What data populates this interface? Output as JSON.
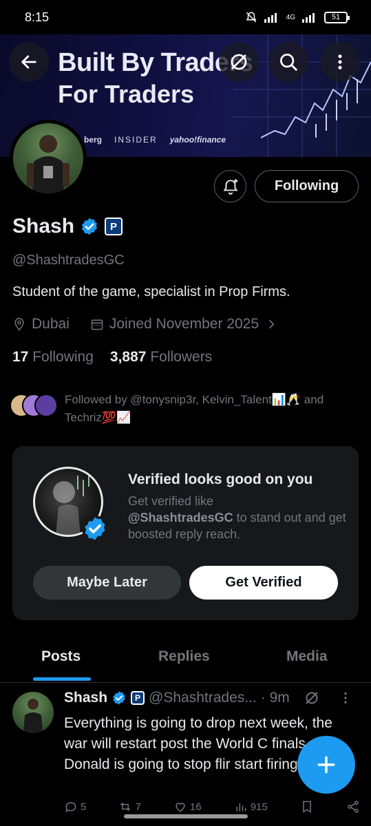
{
  "status_bar": {
    "time": "8:15",
    "network": "4G",
    "battery": "51"
  },
  "banner": {
    "line1": "Built By Traders",
    "line2": "For Traders",
    "logos": [
      "berg",
      "INSIDER",
      "yahoo!finance"
    ]
  },
  "profile": {
    "display_name": "Shash",
    "handle": "@ShashtradesGC",
    "bio": "Student of the game, specialist in Prop Firms.",
    "location": "Dubai",
    "joined": "Joined November 2025",
    "following_count": "17",
    "following_label": "Following",
    "followers_count": "3,887",
    "followers_label": "Followers",
    "followed_by": "Followed by @tonysnip3r, Kelvin_Talent📊🥂 and Techriz💯📈"
  },
  "actions": {
    "following_button": "Following"
  },
  "verify_card": {
    "title": "Verified looks good on you",
    "body_prefix": "Get verified like",
    "body_handle": "@ShashtradesGC",
    "body_suffix": " to stand out and get boosted reply reach.",
    "maybe_later": "Maybe Later",
    "get_verified": "Get Verified"
  },
  "tabs": [
    "Posts",
    "Replies",
    "Media"
  ],
  "post": {
    "name": "Shash",
    "handle": "@Shashtrades...",
    "time": "· 9m",
    "text": "Everything is going to drop next week, the war will restart post the World C finals. Donald is going to stop flir start firing.",
    "counts": {
      "replies": "5",
      "reposts": "7",
      "likes": "16",
      "views": "915"
    }
  },
  "colors": {
    "accent": "#1d9bf0",
    "background": "#000000",
    "muted": "#71767b"
  }
}
